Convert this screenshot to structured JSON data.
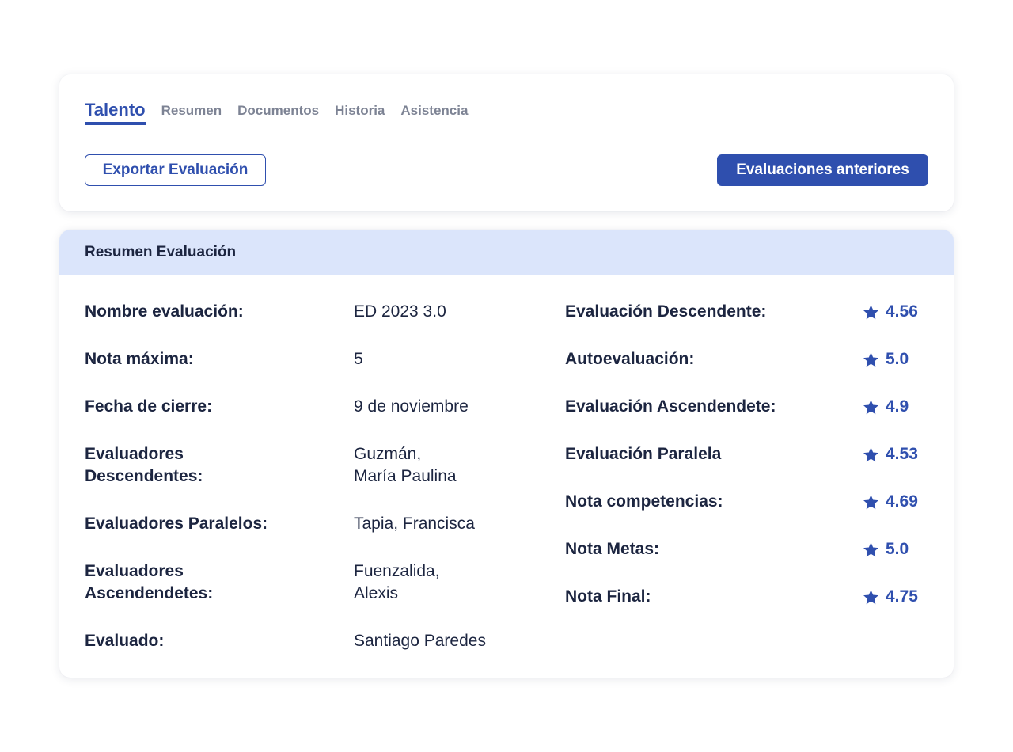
{
  "tabs": [
    {
      "label": "Talento",
      "active": true
    },
    {
      "label": "Resumen"
    },
    {
      "label": "Documentos"
    },
    {
      "label": "Historia"
    },
    {
      "label": "Asistencia"
    }
  ],
  "actions": {
    "export_label": "Exportar Evaluación",
    "previous_label": "Evaluaciones anteriores"
  },
  "summary": {
    "title": "Resumen Evaluación",
    "details": [
      {
        "label": "Nombre evaluación:",
        "value": "ED 2023 3.0"
      },
      {
        "label": "Nota máxima:",
        "value": "5"
      },
      {
        "label": "Fecha de cierre:",
        "value": "9 de noviembre"
      },
      {
        "label": "Evaluadores\nDescendentes:",
        "value": "Guzmán,\nMaría Paulina"
      },
      {
        "label": "Evaluadores Paralelos:",
        "value": "Tapia, Francisca"
      },
      {
        "label": "Evaluadores\nAscendendetes:",
        "value": "Fuenzalida,\nAlexis"
      },
      {
        "label": "Evaluado:",
        "value": "Santiago Paredes"
      }
    ],
    "scores": [
      {
        "label": "Evaluación Descendente:",
        "value": "4.56"
      },
      {
        "label": "Autoevaluación:",
        "value": "5.0"
      },
      {
        "label": "Evaluación Ascendendete:",
        "value": "4.9"
      },
      {
        "label": "Evaluación Paralela",
        "value": "4.53"
      },
      {
        "label": "Nota competencias:",
        "value": "4.69"
      },
      {
        "label": "Nota Metas:",
        "value": "5.0"
      },
      {
        "label": "Nota Final:",
        "value": "4.75"
      }
    ]
  },
  "icons": {
    "score": "star-icon"
  },
  "colors": {
    "accent": "#2f4fae",
    "header_bg": "#dbe5fb",
    "text": "#1c2540",
    "muted": "#7d8394"
  }
}
